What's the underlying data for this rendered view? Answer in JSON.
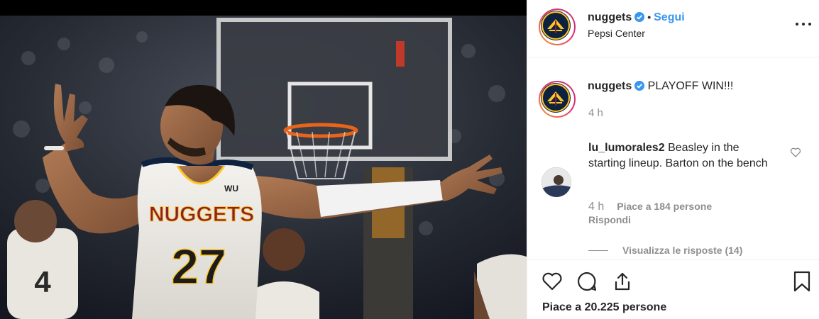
{
  "post": {
    "username": "nuggets",
    "follow_label": "Segui",
    "location": "Pepsi Center",
    "caption_user": "nuggets",
    "caption_text": "PLAYOFF WIN!!!",
    "caption_time": "4 h",
    "likes_label": "Piace a 20.225 persone"
  },
  "comment": {
    "username": "lu_lumorales2",
    "text": "Beasley in the starting lineup. Barton on the bench",
    "time": "4 h",
    "likes": "Piace a 184 persone",
    "reply_label": "Rispondi",
    "view_replies": "Visualizza le risposte (14)"
  },
  "photo": {
    "jersey_team": "NUGGETS",
    "jersey_number": "27",
    "sponsor": "WU"
  },
  "colors": {
    "accent_blue": "#3897f0",
    "navy": "#0e2240",
    "gold": "#fec524",
    "jersey_red": "#8b2131"
  },
  "icons": [
    "verified-icon",
    "more-options-icon",
    "heart-icon",
    "comment-icon",
    "share-icon",
    "bookmark-icon"
  ]
}
